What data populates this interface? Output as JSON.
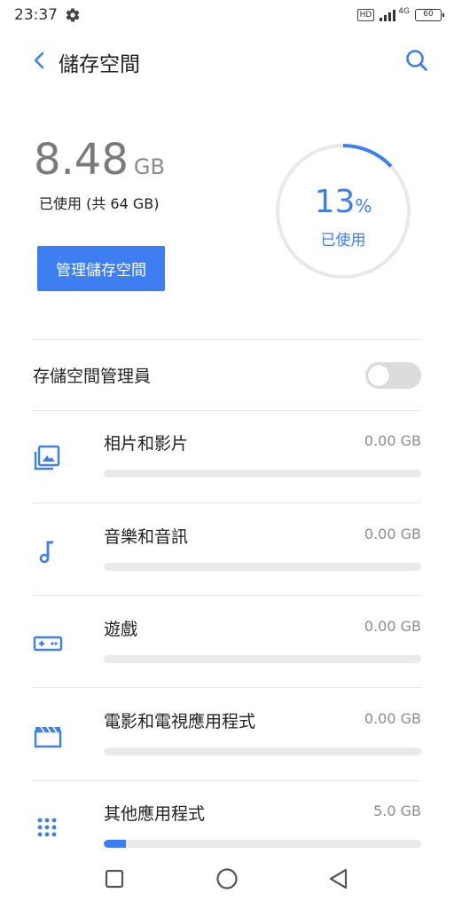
{
  "status_bar": {
    "time": "23:37",
    "hd": "HD",
    "network": "4G",
    "battery": "60",
    "gear_icon": "gear-icon"
  },
  "header": {
    "title": "儲存空間",
    "back_icon": "chevron-left-icon",
    "search_icon": "search-icon"
  },
  "summary": {
    "used_value": "8.48",
    "used_unit": "GB",
    "total_label": "已使用 (共 64 GB)",
    "percent_number": "13",
    "percent_symbol": "%",
    "percent_fraction": 0.13,
    "percent_label": "已使用",
    "manage_button": "管理儲存空間"
  },
  "storage_manager": {
    "label": "存儲空間管理員",
    "enabled": false
  },
  "categories": [
    {
      "name": "相片和影片",
      "size": "0.00 GB",
      "icon": "photos-icon",
      "fraction": 0
    },
    {
      "name": "音樂和音訊",
      "size": "0.00 GB",
      "icon": "music-note-icon",
      "fraction": 0
    },
    {
      "name": "遊戲",
      "size": "0.00 GB",
      "icon": "gamepad-icon",
      "fraction": 0
    },
    {
      "name": "電影和電視應用程式",
      "size": "0.00 GB",
      "icon": "clapperboard-icon",
      "fraction": 0
    },
    {
      "name": "其他應用程式",
      "size": "5.0 GB",
      "icon": "apps-grid-icon",
      "fraction": 0.07
    }
  ],
  "colors": {
    "accent": "#3d7ef1",
    "track": "#eaeaea",
    "muted_text": "#8c8c8c"
  },
  "nav": {
    "recents_icon": "square-icon",
    "home_icon": "circle-icon",
    "back_icon": "triangle-back-icon"
  }
}
